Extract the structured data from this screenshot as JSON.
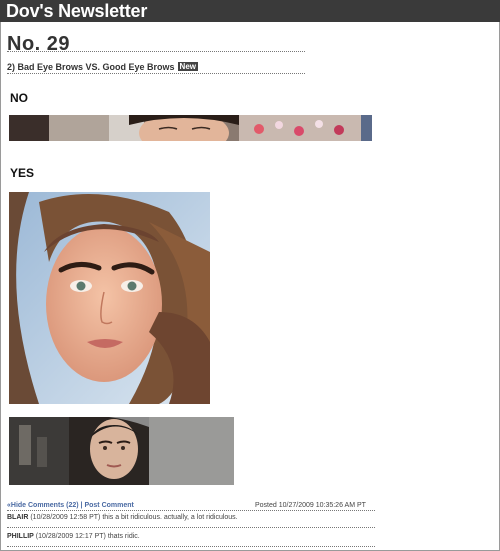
{
  "header": {
    "title": "Dov's Newsletter"
  },
  "issue": {
    "number": "No. 29"
  },
  "post": {
    "title": "2) Bad Eye Brows VS. Good Eye Brows",
    "badge": "New"
  },
  "sections": {
    "no_label": "NO",
    "yes_label": "YES"
  },
  "footer": {
    "hide_comments": "«Hide Comments (22)",
    "separator": "|",
    "post_comment": "Post Comment",
    "posted": "Posted 10/27/2009 10:35:26 AM PT"
  },
  "comments": [
    {
      "author": "BLAIR",
      "meta": "(10/28/2009 12:58 PT)",
      "text": "this a bit ridiculous. actually, a lot ridiculous."
    },
    {
      "author": "PHILLIP",
      "meta": "(10/28/2009 12:17 PT)",
      "text": "thats ridic."
    }
  ],
  "colors": {
    "header_bg": "#3a3a3a",
    "link": "#4a6aa3"
  }
}
